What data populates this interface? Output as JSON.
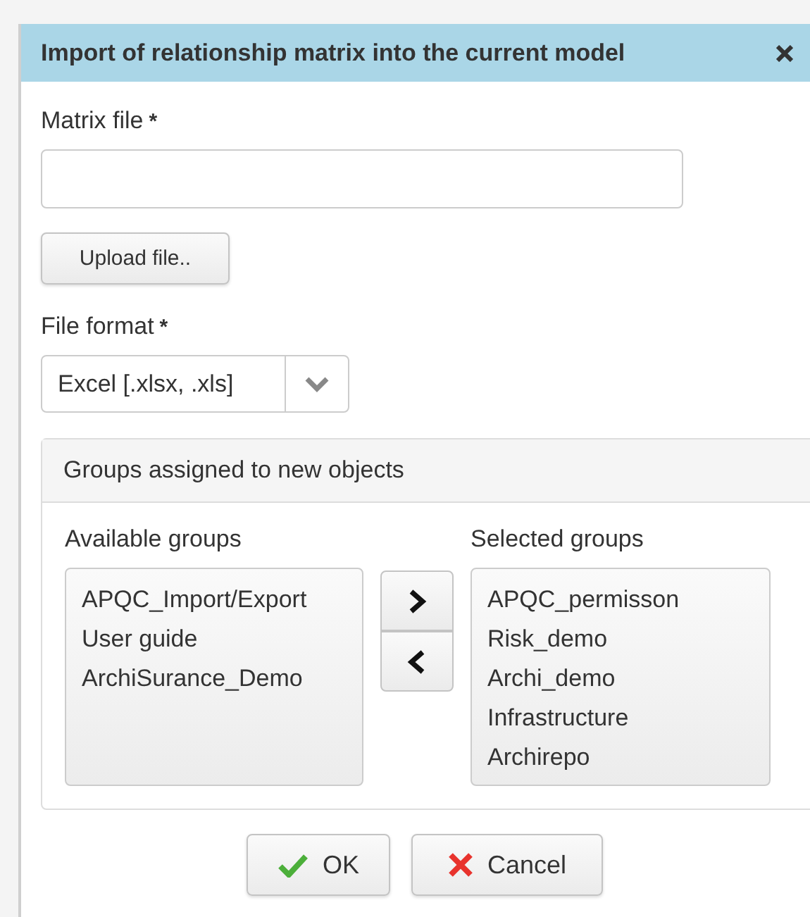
{
  "dialog": {
    "title": "Import of relationship matrix into the current model"
  },
  "matrix_file": {
    "label": "Matrix file",
    "required_mark": "*"
  },
  "upload_button": "Upload file..",
  "file_format": {
    "label": "File format",
    "required_mark": "*",
    "value": "Excel [.xlsx, .xls]"
  },
  "groups_panel": {
    "title": "Groups assigned to new objects",
    "available": {
      "label": "Available groups",
      "items": [
        "APQC_Import/Export",
        "User guide",
        "ArchiSurance_Demo"
      ]
    },
    "selected": {
      "label": "Selected groups",
      "items": [
        "APQC_permisson",
        "Risk_demo",
        "Archi_demo",
        "Infrastructure",
        "Archirepo"
      ]
    }
  },
  "buttons": [
    {
      "label": "OK",
      "kind": "ok"
    },
    {
      "label": "Cancel",
      "kind": "cancel"
    }
  ]
}
